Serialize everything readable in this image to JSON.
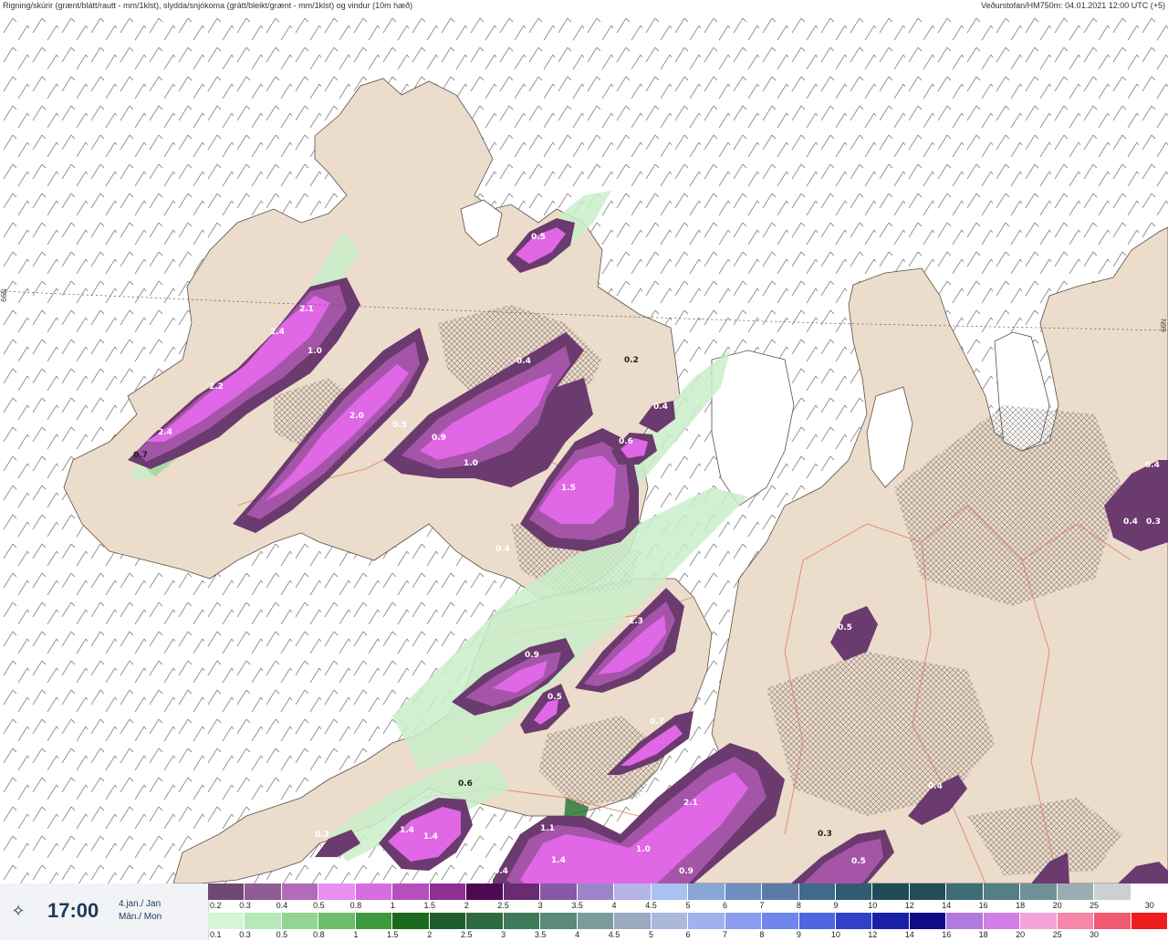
{
  "header": {
    "title_left": "Rigning/skúrir (grænt/blátt/rautt - mm/1klst), slydda/snjókoma (grátt/bleikt/grænt - mm/1klst) og vindur (10m hæð)",
    "title_right": "Veðurstofan/HM750m: 04.01.2021 12:00 UTC (+5)"
  },
  "map": {
    "lat_label_left": "66N",
    "lat_label_right": "66N",
    "colors": {
      "land": "#ecdccb",
      "sea": "#ffffff",
      "rain_light": "#c9eec9",
      "rain_mid": "#9fd99f",
      "rain_dark": "#2f7a3a",
      "snow_dark": "#6b3a6e",
      "snow_mid": "#a455a8",
      "snow_bright": "#e067e6",
      "roads": "#e0785a"
    },
    "precip_labels": [
      {
        "text": "2.1"
      },
      {
        "text": "2.4"
      },
      {
        "text": "1.0"
      },
      {
        "text": "2.2"
      },
      {
        "text": "2.4"
      },
      {
        "text": "0.7"
      },
      {
        "text": "2.0"
      },
      {
        "text": "0.5"
      },
      {
        "text": "0.9"
      },
      {
        "text": "1.0"
      },
      {
        "text": "0.4"
      },
      {
        "text": "1.5"
      },
      {
        "text": "0.6"
      },
      {
        "text": "0.4"
      },
      {
        "text": "0.2"
      },
      {
        "text": "0.5"
      },
      {
        "text": "0.4"
      },
      {
        "text": "1.3"
      },
      {
        "text": "0.9"
      },
      {
        "text": "0.5"
      },
      {
        "text": "0.7"
      },
      {
        "text": "2.1"
      },
      {
        "text": "1.0"
      },
      {
        "text": "0.9"
      },
      {
        "text": "0.3"
      },
      {
        "text": "0.5"
      },
      {
        "text": "0.4"
      },
      {
        "text": "0.5"
      },
      {
        "text": "0.4"
      },
      {
        "text": "0.4"
      },
      {
        "text": "0.3"
      },
      {
        "text": "1.4"
      },
      {
        "text": "1.4"
      },
      {
        "text": "1.1"
      },
      {
        "text": "1.4"
      },
      {
        "text": "0.4"
      },
      {
        "text": "0.3"
      },
      {
        "text": "0.6"
      }
    ]
  },
  "time_panel": {
    "time": "17:00",
    "date_line1": "4.jan./ Jan",
    "date_line2": "Mán./ Mon",
    "icon": "play-forward-icon"
  },
  "legend": {
    "snow": {
      "colors": [
        "#6e4a73",
        "#8f5c94",
        "#b26bb8",
        "#e88ff0",
        "#d66de0",
        "#b44fbd",
        "#8e2f94",
        "#4d0a52",
        "#6a2b74",
        "#845aa6",
        "#9b85c8",
        "#b5b3e8",
        "#a9c2ef",
        "#8aa6d6",
        "#6e8dc0",
        "#5a7aa8",
        "#3f6a8c",
        "#2f5c70",
        "#1f4b57",
        "#234d57",
        "#3c6d78",
        "#557f86",
        "#6f9196",
        "#9aaeb1",
        "#c9d1d3",
        "#ffffff"
      ],
      "ticks": [
        "0.2",
        "0.3",
        "0.4",
        "0.5",
        "0.8",
        "1",
        "1.5",
        "2",
        "2.5",
        "3",
        "3.5",
        "4",
        "4.5",
        "5",
        "6",
        "7",
        "8",
        "9",
        "10",
        "12",
        "14",
        "16",
        "18",
        "20",
        "25",
        "30"
      ]
    },
    "rain": {
      "colors": [
        "#d6f5d6",
        "#b7e8b7",
        "#93d493",
        "#6cbd6c",
        "#3d9a3d",
        "#1c6a1c",
        "#215c2e",
        "#2e6b42",
        "#3f7a5a",
        "#5a8a7a",
        "#7a9a9c",
        "#98a9c0",
        "#aab8dc",
        "#9eb2ec",
        "#8a9df0",
        "#6f86ee",
        "#4f64e0",
        "#3040c8",
        "#1820a8",
        "#120b86",
        "#b07ae0",
        "#d27fe6",
        "#f2a3d8",
        "#f587a8",
        "#f05a70",
        "#ee1c1c"
      ],
      "ticks": [
        "0.1",
        "0.3",
        "0.5",
        "0.8",
        "1",
        "1.5",
        "2",
        "2.5",
        "3",
        "3.5",
        "4",
        "4.5",
        "5",
        "6",
        "7",
        "8",
        "9",
        "10",
        "12",
        "14",
        "16",
        "18",
        "20",
        "25",
        "30"
      ]
    }
  }
}
